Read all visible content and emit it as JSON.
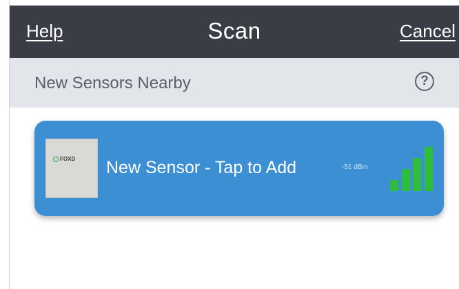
{
  "navbar": {
    "help_label": "Help",
    "title": "Scan",
    "cancel_label": "Cancel"
  },
  "section": {
    "title": "New Sensors Nearby",
    "help_icon_glyph": "?",
    "help_icon": "question-circle-icon"
  },
  "sensor_card": {
    "label": "New Sensor - Tap to Add",
    "rssi_text": "-51 dBm",
    "thumbnail_logo_text": "FOXD",
    "signal_icon": "signal-strength-icon",
    "signal_level": 0.9
  },
  "colors": {
    "navbar_bg": "#3a3d45",
    "section_bg": "#e2e5ea",
    "card_bg": "#3d8fd3",
    "signal_green": "#2fbd3d"
  }
}
